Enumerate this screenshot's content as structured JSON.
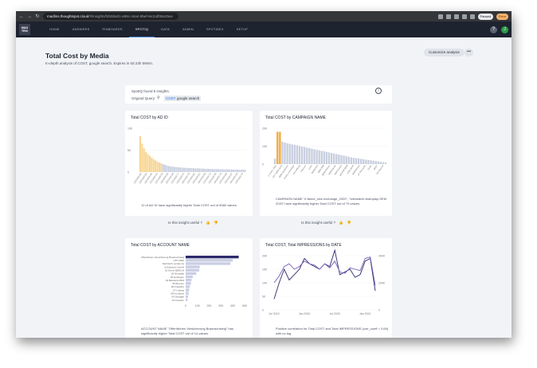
{
  "browser": {
    "url_host": "madlins.thoughtspot.cloud",
    "url_path": "/#/insights/f4b5ba01-a99c-44a4-9bef-6e11df05e25ee",
    "paused_label": "Paused",
    "error_label": "Error"
  },
  "app": {
    "logo_text": "MAD TRIX",
    "tabs": [
      "HOME",
      "ANSWERS",
      "PINBOARDS",
      "SPOTIQ",
      "DATA",
      "ADMIN",
      "SPOTIDEX",
      "SETUP"
    ],
    "active_tab": "SPOTIQ",
    "help_label": "?",
    "user_initial": "J"
  },
  "page": {
    "title": "Total Cost by Media",
    "subtitle": "In-depth analysis of COST, google search. Expires in 0d 23h 59min.",
    "customize_label": "Customize analysis",
    "more_label": "•••"
  },
  "summary": {
    "found_text": "SpotIQ found 5 insights.",
    "query_label": "Original Query:",
    "chips": [
      "COST",
      "google search"
    ]
  },
  "cards": [
    {
      "title": "Total COST by AD ID",
      "description": "12 of AD ID have significantly higher Total COST out of 5080 values.",
      "useful_label": "Is this insight useful ?"
    },
    {
      "title": "Total COST by CAMPAIGN NAME",
      "description": "CAMPAIGN NAME \"e-factor_sick exchange_2020\", \"vitesstech-teamplay-SEM 2020\" have significantly higher Total COST out of 79 values.",
      "useful_label": "Is this insight useful ?"
    },
    {
      "title": "Total COST by ACCOUNT NAME",
      "description": "ACCOUNT NAME \"Offentlichen Versicherung Braunschweig\" has significantly higher Total COST out of 14 values."
    },
    {
      "title": "Total COST, Total IMPRESSIONS by DATE",
      "description": "Positive correlation for Total COST and Total IMPRESSIONS (corr_coeff = 0.69) with no lag"
    }
  ],
  "colors": {
    "highlight_orange": "#f2a93b",
    "highlight_yellow": "#f7d38a",
    "bar_grey": "#c7cede",
    "bar_dark": "#2c2a6b",
    "bar_light": "#c9cee3",
    "line_dark": "#2c2a6b",
    "line_purple": "#7b5fb8"
  },
  "chart_data": [
    {
      "type": "bar",
      "title": "Total COST by AD ID",
      "yticks": [
        "10K",
        "5K",
        "0"
      ],
      "ylim": [
        0,
        10000
      ],
      "values": [
        8200,
        6500,
        5400,
        4600,
        4100,
        3700,
        3300,
        3000,
        2700,
        2400,
        2200,
        2000,
        1800,
        1650,
        1500,
        1400,
        1300,
        1250,
        1200,
        1150,
        1100,
        1050,
        1000,
        980,
        960,
        940,
        920,
        900,
        880,
        860,
        840,
        820,
        800,
        780,
        760,
        740,
        720,
        700,
        690,
        680,
        670,
        660,
        650,
        640,
        630,
        620,
        610,
        600,
        590,
        580,
        570,
        560,
        550,
        540,
        530,
        520
      ],
      "highlight_count": 12,
      "tick_labels": [
        "2352420783",
        "2352420780",
        "2352420785",
        "2352420791",
        "2352420793",
        "2352420786",
        "2352420794",
        "2352420777",
        "2352420797",
        "2352420778",
        "2352420782",
        "2352420781",
        "2352420790",
        "2352420775",
        "2352420796",
        "2352420779",
        "2352420788",
        "2352420787",
        "2352420789",
        "2352420776"
      ]
    },
    {
      "type": "bar",
      "title": "Total COST by CAMPAIGN NAME",
      "yticks": [
        "20K",
        "10K",
        "0"
      ],
      "ylim": [
        0,
        20000
      ],
      "values": [
        3000,
        18000,
        18000,
        12500,
        12000,
        11600,
        11300,
        11000,
        10800,
        10500,
        10100,
        9800,
        9500,
        9200,
        8900,
        8600,
        8300,
        8000,
        7700,
        7400,
        7100,
        6800,
        6500,
        6200,
        5900,
        5600,
        5300,
        5000,
        4700,
        4400,
        4100,
        3800,
        3500,
        3300,
        3100,
        2900,
        2700,
        2500,
        2300,
        2100,
        1900,
        1700,
        1500,
        1300,
        1100,
        900
      ],
      "highlight_indexes": [
        1,
        2
      ],
      "tick_labels": [
        "a_factor_Sick",
        "CPT SEM 2020",
        "SEM Suchfarm",
        "brand_exchange",
        "Verwaltung",
        "Telecom",
        "Lotto",
        "Wetterfest",
        "SEM IBM",
        "SEM Rmpay",
        "SEM Barrip",
        "RDS Brand",
        "2020 M SEM",
        "GSS 2020",
        "SEM Brand",
        "ST Rewards",
        "Sales",
        "SPAT",
        "GS Search"
      ]
    },
    {
      "type": "bar",
      "orientation": "horizontal",
      "title": "Total COST by ACCOUNT NAME",
      "categories": [
        "Offentlichen Versicherung Braunschweig",
        "HTP 2020",
        "Nachtschi Leinde de",
        "a-Solutions GmbH",
        "01 Grone BERLIN",
        "02 Neustadt",
        "03 Gottingen",
        "04 Bielefeld 2019",
        "05 Bremen",
        "06 Frankfurt",
        "07 Leipzig",
        "08 Konstanz",
        "09 Stuttgart",
        "10 Dresden"
      ],
      "values": [
        45000,
        40000,
        38000,
        12000,
        11500,
        9000,
        6000,
        5000,
        4500,
        3500,
        3000,
        2500,
        2000,
        1500
      ],
      "highlight_indexes": [
        0
      ],
      "xticks": [
        "0",
        "10K",
        "20K",
        "30K",
        "40K",
        "50K"
      ],
      "xlim": [
        0,
        50000
      ]
    },
    {
      "type": "line",
      "title": "Total COST, Total IMPRESSIONS by DATE",
      "x": [
        "Jul 2019",
        "Aug 2019",
        "Sep 2019",
        "Oct 2019",
        "Nov 2019",
        "Dec 2019",
        "Jan 2020",
        "Feb 2020",
        "Mar 2020",
        "Apr 2020",
        "May 2020",
        "Jun 2020",
        "Jul 2020",
        "Aug 2020",
        "Sep 2020",
        "Oct 2020",
        "Nov 2020",
        "Dec 2020",
        "Jan 2021",
        "Feb 2021",
        "Mar 2021"
      ],
      "series": [
        {
          "axis": "left",
          "values": [
            4000,
            10000,
            15000,
            11000,
            13000,
            15000,
            19000,
            17000,
            16000,
            15000,
            17000,
            16000,
            22000,
            13000,
            14000,
            15000,
            12000,
            13000,
            18000,
            19000,
            7000
          ]
        },
        {
          "axis": "right",
          "values": [
            200000,
            250000,
            320000,
            340000,
            300000,
            320000,
            360000,
            340000,
            330000,
            300000,
            340000,
            310000,
            360000,
            280000,
            270000,
            310000,
            300000,
            290000,
            380000,
            390000,
            180000
          ]
        }
      ],
      "yticks_left": [
        "20K",
        "15K",
        "10K",
        "5K",
        "0"
      ],
      "ylim_left": [
        0,
        20000
      ],
      "yticks_right": [
        "400K",
        "200K",
        "0"
      ],
      "ylim_right": [
        0,
        400000
      ],
      "xticks": [
        "Jul 2019",
        "Jan 2020",
        "Jul 2020",
        "Jan 2021"
      ]
    }
  ]
}
